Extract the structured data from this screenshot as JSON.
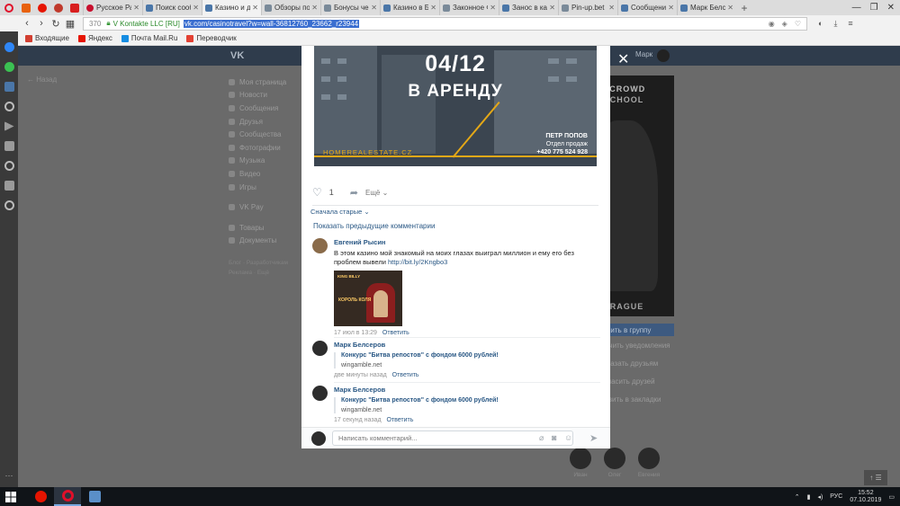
{
  "browser": {
    "tabs": [
      {
        "label": "Русское Радио",
        "icon": "red"
      },
      {
        "label": "Поиск сообщений",
        "icon": "vk"
      },
      {
        "label": "Казино и джекпот",
        "icon": "vk",
        "active": true
      },
      {
        "label": "Обзоры покер-румов",
        "icon": "grey"
      },
      {
        "label": "Бонусы честные",
        "icon": "grey"
      },
      {
        "label": "Казино в Беларуси",
        "icon": "vk"
      },
      {
        "label": "Законное Фото",
        "icon": "grey"
      },
      {
        "label": "Занос в казино",
        "icon": "vk"
      },
      {
        "label": "Pin-up.bet Pin-up",
        "icon": "grey"
      },
      {
        "label": "Сообщения",
        "icon": "vk"
      },
      {
        "label": "Марк Белсеров",
        "icon": "vk"
      }
    ],
    "url": {
      "num": "370",
      "org": "V Kontakte LLC [RU]",
      "value": "vk.com/casinotravel?w=wall-36812760_23662_r23944"
    },
    "bookmarks": [
      {
        "label": "Входящие",
        "color": "#d23f31"
      },
      {
        "label": "Яндекс",
        "color": "#e61400"
      },
      {
        "label": "Почта Mail.Ru",
        "color": "#168de2"
      },
      {
        "label": "Переводчик",
        "color": "#e34133"
      }
    ],
    "colors": {
      "opera_red": "#e0102a",
      "highlight": "#3a6ed0"
    }
  },
  "vk": {
    "logo": "VK",
    "header_user": "Марк",
    "back": "Назад",
    "menu": [
      "Моя страница",
      "Новости",
      "Сообщения",
      "Друзья",
      "Сообщества",
      "Фотографии",
      "Музыка",
      "Видео",
      "Игры",
      "VK Pay",
      "Товары",
      "Документы"
    ],
    "footer_links": [
      "Блог · Разработчикам",
      "Реклама · Ещё"
    ],
    "poster": {
      "line1": "MCROWD",
      "line2": "SCHOOL",
      "line3": "PRAGUE"
    },
    "join_button": "Вступить в группу",
    "right_links": [
      "Включить уведомления",
      "Рассказать друзьям",
      "Пригласить друзей",
      "Добавить в закладки"
    ],
    "friends": [
      "Иван",
      "Олег",
      "Евгения"
    ],
    "brand_color": "#4a76a8"
  },
  "post": {
    "banner": {
      "date": "04/12",
      "headline": "В АРЕНДУ",
      "site": "HOMEREALESTATE.CZ",
      "agent_name": "ПЕТР ПОПОВ",
      "agent_role": "Отдел продаж",
      "agent_phone": "+420 775 524 928",
      "accent": "#e4a817"
    },
    "likes": "1",
    "more_label": "Ещё",
    "sort_label": "Сначала старые",
    "show_previous": "Показать предыдущие комментарии",
    "comments": [
      {
        "author": "Евгений Рысин",
        "text": "В этом казино мой знакомый на моих глазах выиграл миллион и ему его без проблем вывели",
        "link": "http://bit.ly/2Kngbo3",
        "image_labels": [
          "KING BILLY",
          "КОРОЛЬ КОЛЯ"
        ],
        "time": "17 июл в 13:29",
        "reply": "Ответить"
      },
      {
        "author": "Марк Белсеров",
        "quote_title": "Конкурс \"Битва репостов\" с фондом 6000 рублей!",
        "quote_domain": "wingamble.net",
        "time": "две минуты назад",
        "reply": "Ответить"
      },
      {
        "author": "Марк Белсеров",
        "quote_title": "Конкурс \"Битва репостов\" с фондом 6000 рублей!",
        "quote_domain": "wingamble.net",
        "time": "17 секунд назад",
        "reply": "Ответить"
      }
    ],
    "composer_placeholder": "Написать комментарий..."
  },
  "taskbar": {
    "lang": "РУС",
    "time": "15:52",
    "date": "07.10.2019"
  }
}
